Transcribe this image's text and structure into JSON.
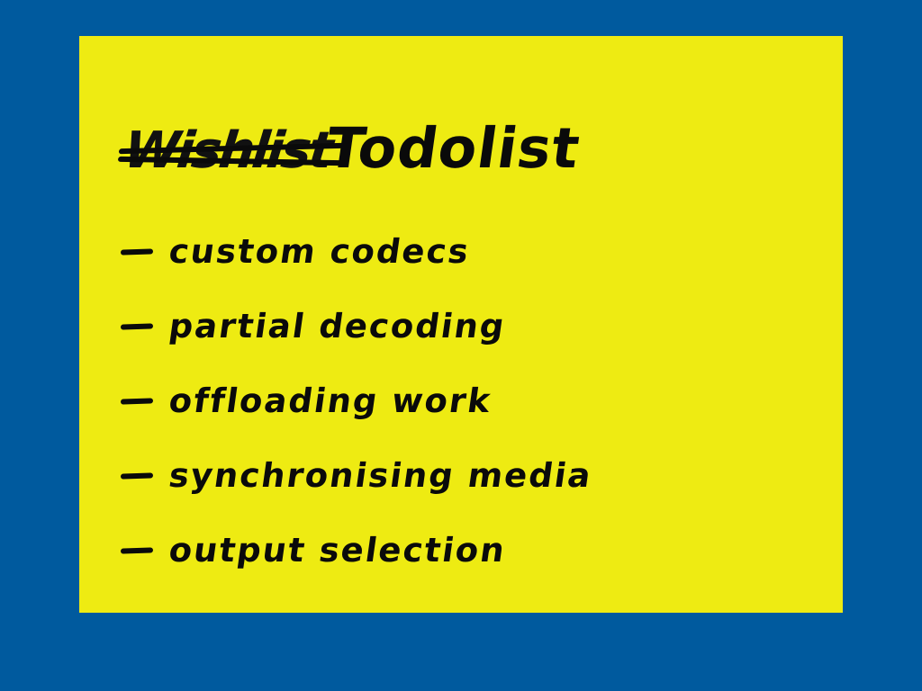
{
  "slide": {
    "title_struck": "Wishlist",
    "title": "Todolist",
    "items": [
      "custom codecs",
      "partial decoding",
      "offloading work",
      "synchronising media",
      "output selection"
    ]
  },
  "colors": {
    "background": "#005a9e",
    "note": "#eeeb12",
    "ink": "#0a0a0a"
  }
}
